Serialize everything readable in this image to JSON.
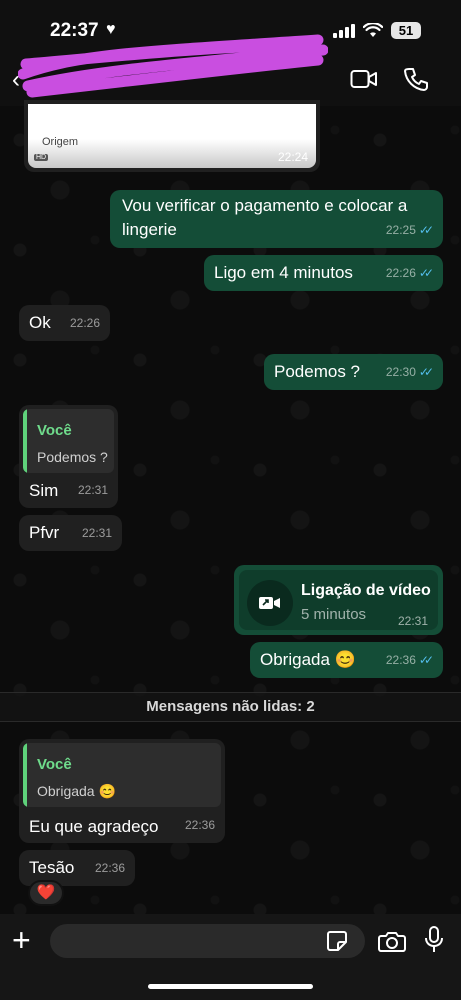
{
  "status_bar": {
    "time": "22:37",
    "heart": "♥",
    "battery": "51"
  },
  "header": {
    "back_icon": "chevron-left-icon",
    "contact_name": ""
  },
  "messages": {
    "image": {
      "caption": "Origem",
      "hd": "HD",
      "time": "22:24"
    },
    "m1": {
      "text": "Vou verificar o pagamento e colocar a lingerie",
      "time": "22:25"
    },
    "m2": {
      "text": "Ligo em 4 minutos",
      "time": "22:26"
    },
    "m3": {
      "text": "Ok",
      "time": "22:26"
    },
    "m4": {
      "text": "Podemos ?",
      "time": "22:30"
    },
    "m5": {
      "quote_author": "Você",
      "quote_text": "Podemos ?",
      "text": "Sim",
      "time": "22:31"
    },
    "m6": {
      "text": "Pfvr",
      "time": "22:31"
    },
    "call": {
      "title": "Ligação de vídeo",
      "subtitle": "5 minutos",
      "time": "22:31"
    },
    "m7": {
      "text": "Obrigada 😊",
      "time": "22:36"
    },
    "unread": "Mensagens não lidas: 2",
    "m8": {
      "quote_author": "Você",
      "quote_text": "Obrigada 😊",
      "text": "Eu que agradeço",
      "time": "22:36"
    },
    "m9": {
      "text": "Tesão",
      "time": "22:36",
      "reaction": "❤️"
    }
  },
  "input": {
    "placeholder": ""
  },
  "colors": {
    "outgoing": "#144d37",
    "incoming": "#202020",
    "read_ticks": "#53bdeb",
    "quote_author": "#6fdc8c"
  }
}
